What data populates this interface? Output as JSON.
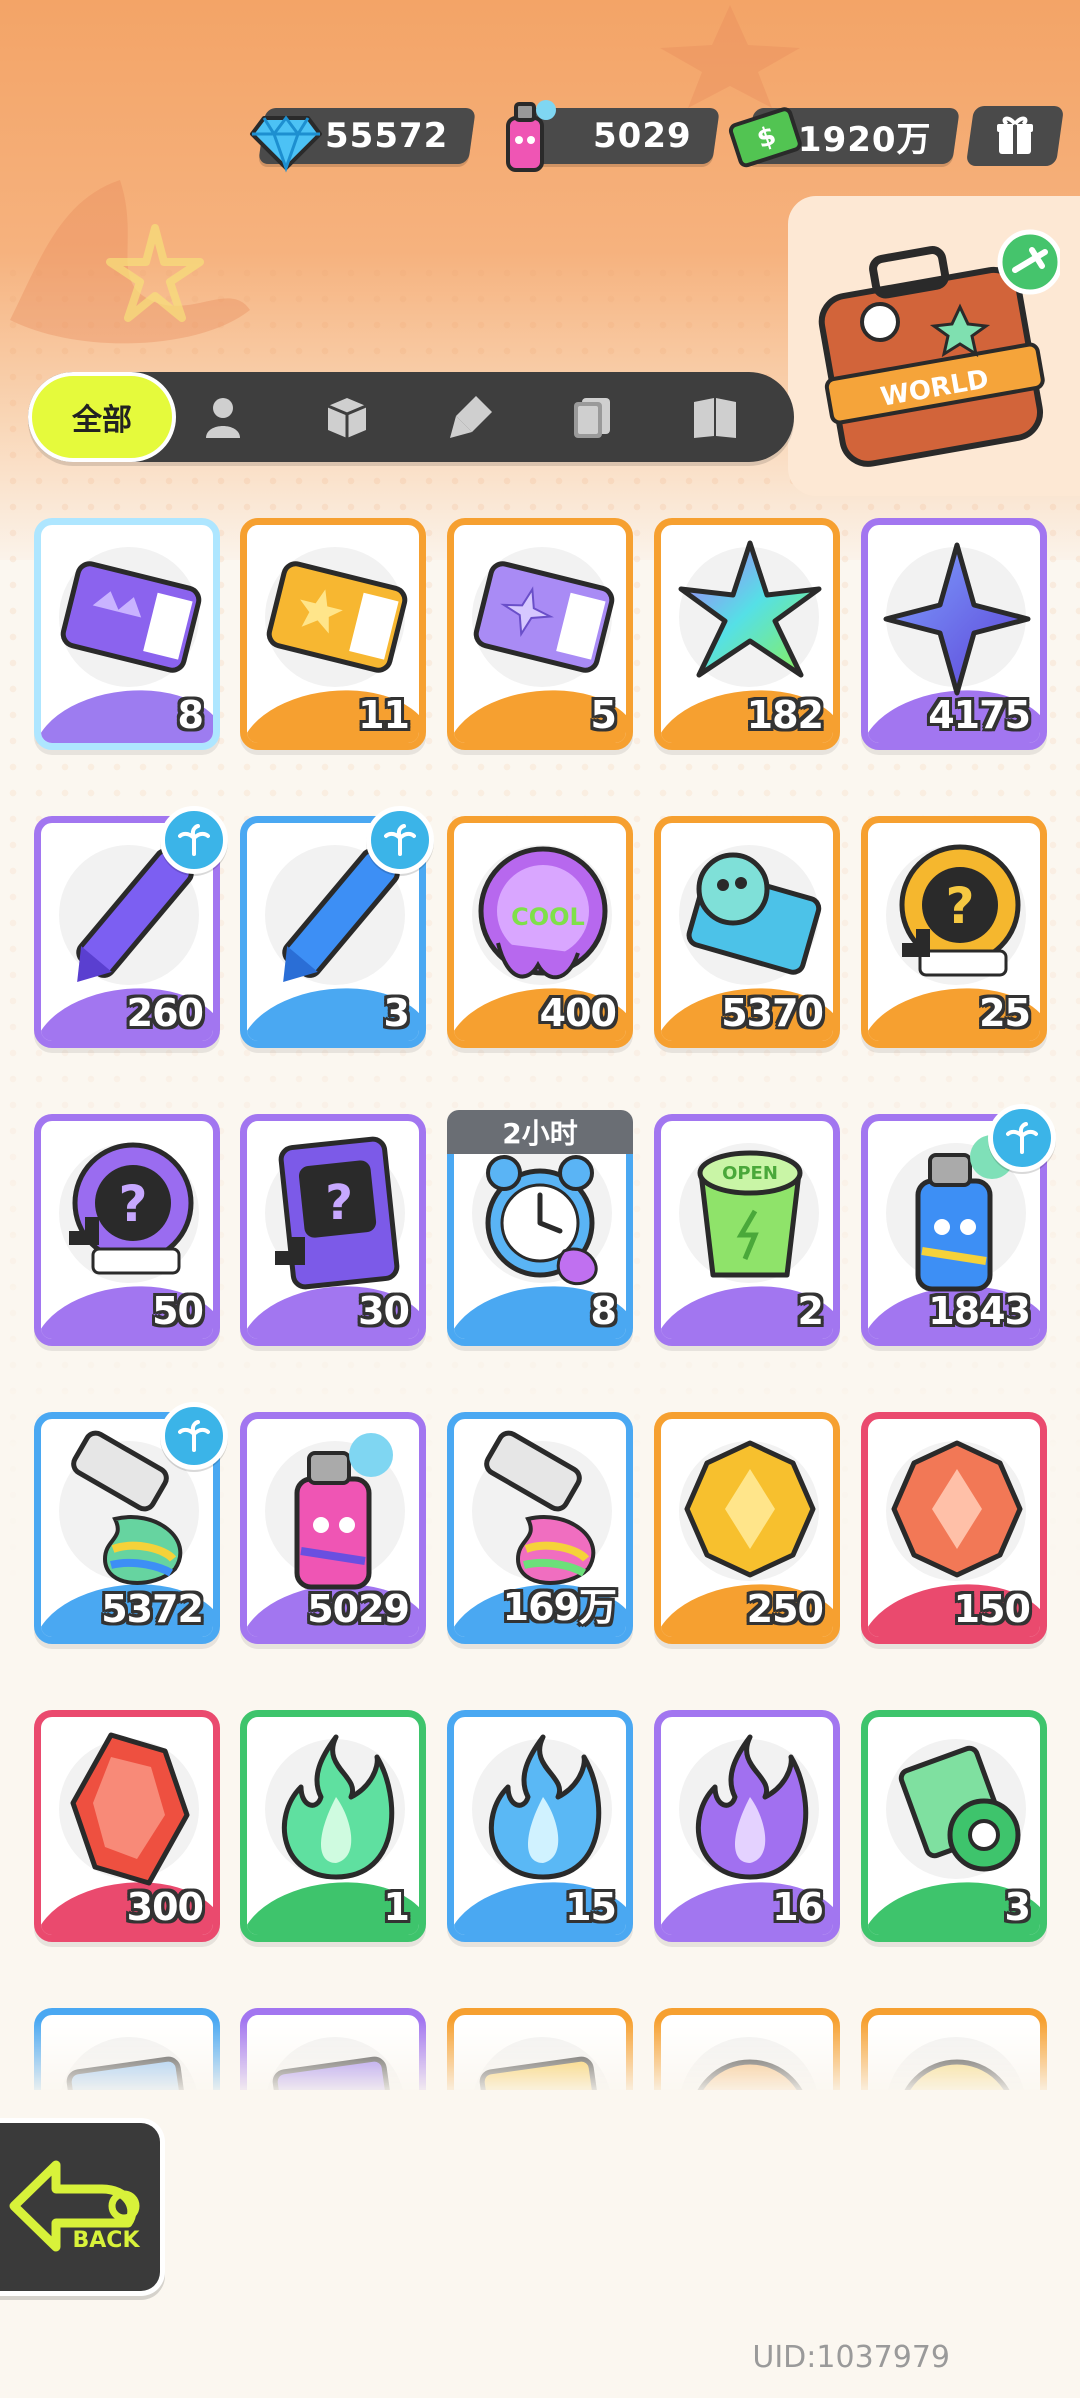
{
  "currencies": [
    {
      "name": "diamond",
      "icon": "diamond-icon",
      "value": "55572"
    },
    {
      "name": "spray",
      "icon": "spray-can-icon",
      "value": "5029"
    },
    {
      "name": "cash",
      "icon": "cash-icon",
      "value": "1920万"
    }
  ],
  "gift_icon": "gift-box-icon",
  "suitcase": {
    "icon": "travel-suitcase-icon",
    "label": "WORLD"
  },
  "tabs": {
    "all_label": "全部",
    "icons": [
      "character-icon",
      "box-icon",
      "spray-brush-icon",
      "card-icon",
      "book-icon"
    ]
  },
  "items": [
    {
      "name": "purple-ticket",
      "count": "8",
      "frame": "rainbow"
    },
    {
      "name": "gold-ticket",
      "count": "11",
      "frame": "orange"
    },
    {
      "name": "violet-ticket",
      "count": "5",
      "frame": "orange"
    },
    {
      "name": "rainbow-star-crystal",
      "count": "182",
      "frame": "orange"
    },
    {
      "name": "blue-star-crystal",
      "count": "4175",
      "frame": "purple"
    },
    {
      "name": "purple-crayon",
      "count": "260",
      "frame": "purple",
      "badge": "palm-icon"
    },
    {
      "name": "blue-crayon",
      "count": "3",
      "frame": "blue",
      "badge": "palm-icon"
    },
    {
      "name": "cool-sticker",
      "count": "400",
      "frame": "orange"
    },
    {
      "name": "season-ticket",
      "count": "5370",
      "frame": "orange"
    },
    {
      "name": "gold-mystery-badge",
      "count": "25",
      "frame": "orange"
    },
    {
      "name": "purple-mystery-badge",
      "count": "50",
      "frame": "purple"
    },
    {
      "name": "travel-mystery-card",
      "count": "30",
      "frame": "purple"
    },
    {
      "name": "alarm-clock",
      "count": "8",
      "frame": "blue",
      "timer": "2小时"
    },
    {
      "name": "green-cup",
      "count": "2",
      "frame": "purple"
    },
    {
      "name": "blue-spray-can",
      "count": "1843",
      "frame": "purple",
      "badge": "palm-icon"
    },
    {
      "name": "paint-tube",
      "count": "5372",
      "frame": "blue",
      "badge": "palm-icon"
    },
    {
      "name": "pink-spray-can",
      "count": "5029",
      "frame": "purple"
    },
    {
      "name": "rainbow-paint-tube",
      "count": "169万",
      "frame": "blue"
    },
    {
      "name": "gold-gem",
      "count": "250",
      "frame": "orange"
    },
    {
      "name": "red-gem",
      "count": "150",
      "frame": "red"
    },
    {
      "name": "red-crystal",
      "count": "300",
      "frame": "red"
    },
    {
      "name": "green-flame",
      "count": "1",
      "frame": "green"
    },
    {
      "name": "blue-flame",
      "count": "15",
      "frame": "blue"
    },
    {
      "name": "purple-flame",
      "count": "16",
      "frame": "purple"
    },
    {
      "name": "green-tape",
      "count": "3",
      "frame": "green"
    },
    {
      "name": "blue-card-pack",
      "count": "",
      "frame": "blue"
    },
    {
      "name": "purple-card-pack",
      "count": "",
      "frame": "purple"
    },
    {
      "name": "gold-card-pack",
      "count": "",
      "frame": "orange"
    },
    {
      "name": "character-token-1",
      "count": "",
      "frame": "orange"
    },
    {
      "name": "character-token-2",
      "count": "",
      "frame": "orange"
    }
  ],
  "back": {
    "label": "BACK",
    "icon": "back-arrow-icon"
  },
  "uid": "UID:1037979"
}
